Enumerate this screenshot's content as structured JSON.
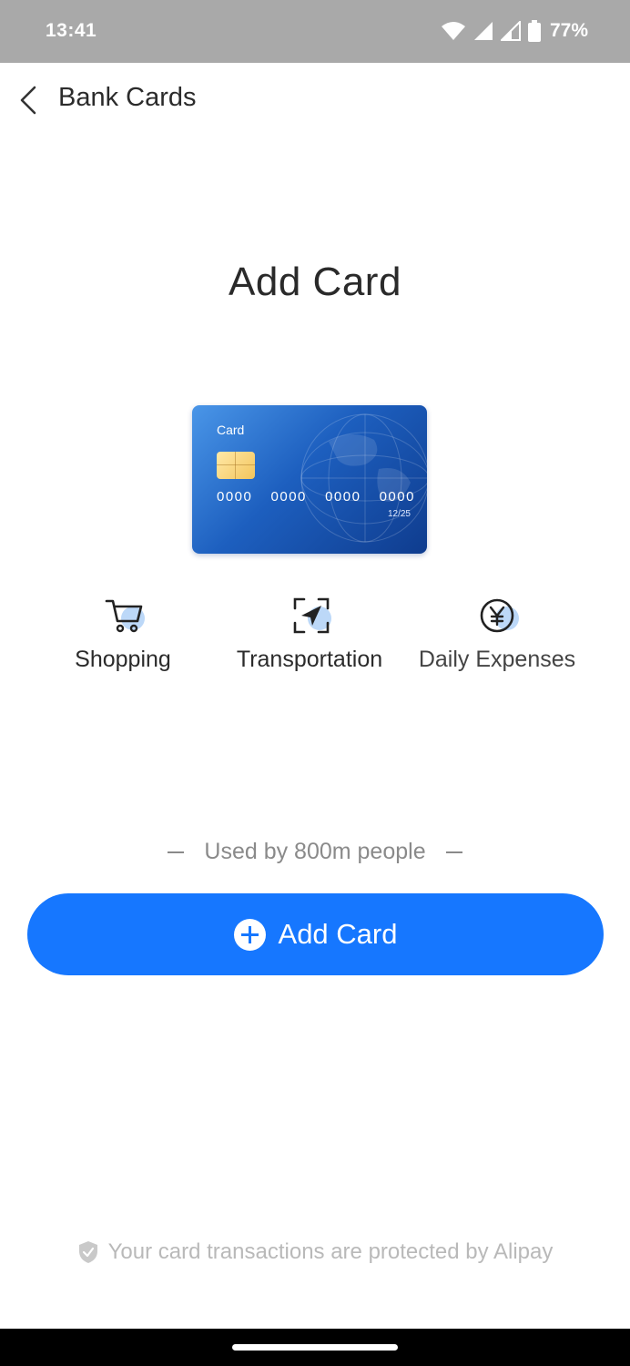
{
  "status_bar": {
    "time": "13:41",
    "battery": "77%"
  },
  "header": {
    "title": "Bank Cards"
  },
  "main": {
    "title": "Add Card",
    "card": {
      "label": "Card",
      "number_groups": [
        "0000",
        "0000",
        "0000",
        "0000"
      ],
      "expiry": "12/25"
    },
    "features": [
      {
        "label": "Shopping",
        "icon": "shopping-cart-icon"
      },
      {
        "label": "Transportation",
        "icon": "transport-navigation-icon"
      },
      {
        "label": "Daily Expenses",
        "icon": "yen-coin-icon"
      }
    ],
    "used_by": "Used by 800m people",
    "add_button_label": "Add Card",
    "protection_note": "Your card transactions are protected by Alipay"
  },
  "colors": {
    "accent": "#1677ff",
    "status_bar": "#a9a9a9",
    "card_dark": "#0f3c8e"
  }
}
